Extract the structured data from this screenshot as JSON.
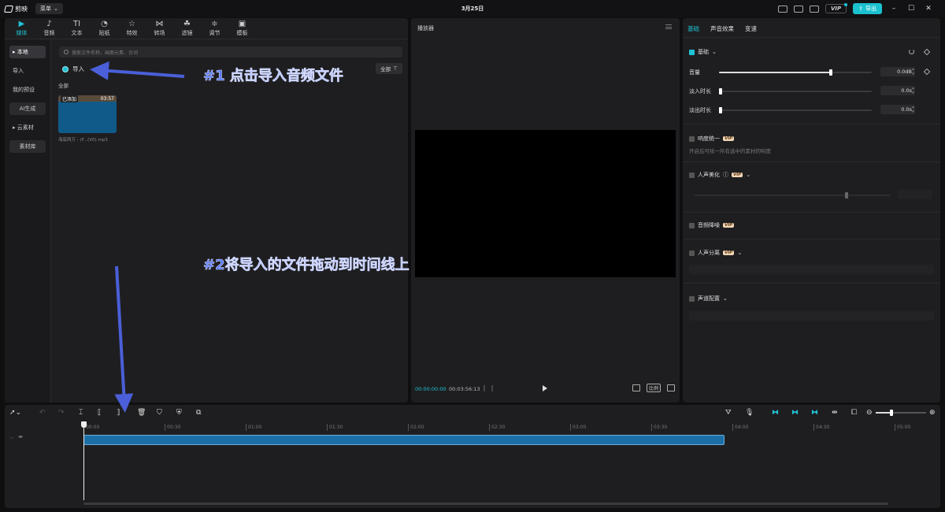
{
  "titlebar": {
    "app_name": "剪映",
    "menu_label": "菜单",
    "window_title": "3月25日",
    "vip_label": "VIP",
    "export_label": "导出"
  },
  "media_toolbar": {
    "items": [
      {
        "label": "媒体",
        "icon": "media-icon",
        "glyph": "▶"
      },
      {
        "label": "音频",
        "icon": "audio-icon",
        "glyph": "♪"
      },
      {
        "label": "文本",
        "icon": "text-icon",
        "glyph": "TI"
      },
      {
        "label": "贴纸",
        "icon": "sticker-icon",
        "glyph": "◔"
      },
      {
        "label": "特效",
        "icon": "effects-icon",
        "glyph": "☆"
      },
      {
        "label": "转场",
        "icon": "transition-icon",
        "glyph": "⋈"
      },
      {
        "label": "滤镜",
        "icon": "filter-icon",
        "glyph": "☘"
      },
      {
        "label": "调节",
        "icon": "adjust-icon",
        "glyph": "≑"
      },
      {
        "label": "模板",
        "icon": "template-icon",
        "glyph": "▣"
      }
    ]
  },
  "sidebar": {
    "items": [
      {
        "label": "▸ 本地"
      },
      {
        "label": "导入"
      },
      {
        "label": "我的预设"
      },
      {
        "label": "AI生成"
      },
      {
        "label": "▸ 云素材"
      },
      {
        "label": "素材库"
      }
    ]
  },
  "media": {
    "search_placeholder": "搜索文件名称、画面元素、台词",
    "import_label": "导入",
    "filter_label": "全部",
    "all_label": "全部",
    "clip": {
      "added_label": "已添加",
      "duration": "03:57",
      "filename": "海底两万 - (F...(V0).mp3"
    }
  },
  "annotations": {
    "step1": "#1 点击导入音频文件",
    "step2": "#2将导入的文件拖动到时间线上"
  },
  "player": {
    "title": "播放器",
    "current_time": "00:00:00:00",
    "total_time": "00:03:56:13",
    "ratio_label": "比例"
  },
  "inspector": {
    "tabs": [
      "基础",
      "声音效果",
      "变速"
    ],
    "basic_label": "基础",
    "volume_label": "音量",
    "volume_value": "0.0dB",
    "fade_in_label": "淡入时长",
    "fade_in_value": "0.0s",
    "fade_out_label": "淡出时长",
    "fade_out_value": "0.0s",
    "loudness_label": "响度统一",
    "loudness_desc": "开启后可统一所有选中的素材的响度",
    "vocal_beauty_label": "人声美化",
    "noise_label": "音频降噪",
    "vocal_sep_label": "人声分离",
    "voice_change_label": "声道配置",
    "vip_tag": "VIP"
  },
  "timeline": {
    "ticks": [
      "00:00",
      "00:30",
      "01:00",
      "01:30",
      "02:00",
      "02:30",
      "03:00",
      "03:30",
      "04:00",
      "04:30",
      "05:00"
    ]
  },
  "colors": {
    "accent": "#1fc2d4",
    "annotation": "#5a7bf7",
    "clip_blue": "#1c6fa6"
  }
}
